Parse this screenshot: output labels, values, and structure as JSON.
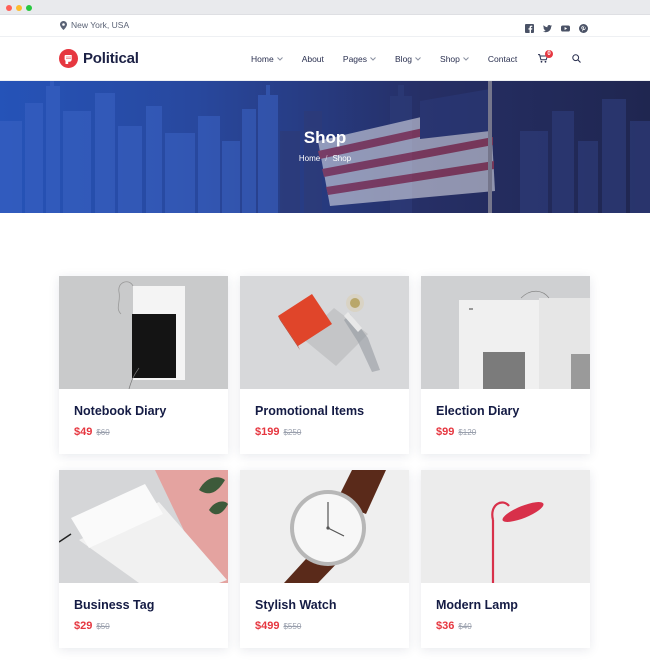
{
  "window": {
    "dots": [
      "#ff5f57",
      "#febc2e",
      "#28c840"
    ]
  },
  "topbar": {
    "location": "New York, USA",
    "social": [
      "facebook-icon",
      "twitter-icon",
      "youtube-icon",
      "pinterest-icon"
    ]
  },
  "brand": {
    "name": "Political",
    "accent": "#e63740",
    "navy": "#141b44"
  },
  "nav": {
    "items": [
      "Home",
      "About",
      "Pages",
      "Blog",
      "Shop",
      "Contact"
    ],
    "cart_count": "0"
  },
  "hero": {
    "title": "Shop",
    "breadcrumb": [
      "Home",
      "Shop"
    ],
    "separator": "/"
  },
  "products": [
    {
      "name": "Notebook Diary",
      "price": "$49",
      "old_price": "$60"
    },
    {
      "name": "Promotional Items",
      "price": "$199",
      "old_price": "$250"
    },
    {
      "name": "Election Diary",
      "price": "$99",
      "old_price": "$120"
    },
    {
      "name": "Business Tag",
      "price": "$29",
      "old_price": "$50"
    },
    {
      "name": "Stylish Watch",
      "price": "$499",
      "old_price": "$550"
    },
    {
      "name": "Modern Lamp",
      "price": "$36",
      "old_price": "$40"
    }
  ]
}
